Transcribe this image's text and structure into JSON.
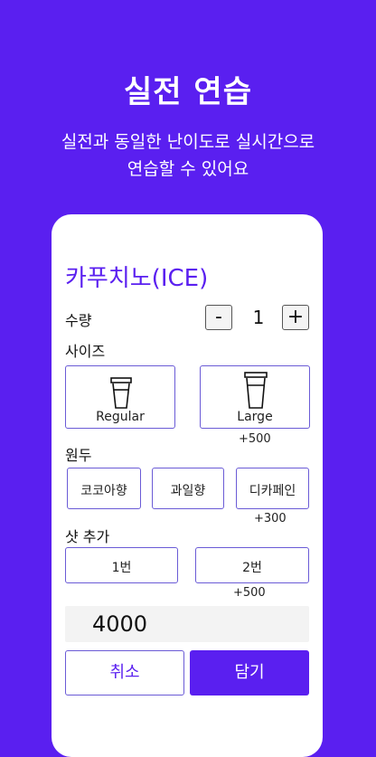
{
  "hero": {
    "title": "실전 연습",
    "subtitle_line1": "실전과 동일한 난이도로 실시간으로",
    "subtitle_line2": "연습할 수 있어요"
  },
  "product": {
    "name": "카푸치노(ICE)"
  },
  "quantity": {
    "label": "수량",
    "minus": "-",
    "value": "1",
    "plus": "+"
  },
  "size": {
    "label": "사이즈",
    "options": [
      {
        "label": "Regular",
        "extra": "",
        "icon": "cup-icon"
      },
      {
        "label": "Large",
        "extra": "+500",
        "icon": "cup-icon"
      }
    ]
  },
  "beans": {
    "label": "원두",
    "options": [
      {
        "label": "코코아향",
        "extra": ""
      },
      {
        "label": "과일향",
        "extra": ""
      },
      {
        "label": "디카페인",
        "extra": "+300"
      }
    ]
  },
  "shot": {
    "label": "샷 추가",
    "options": [
      {
        "label": "1번",
        "extra": ""
      },
      {
        "label": "2번",
        "extra": "+500"
      }
    ]
  },
  "price": {
    "total": "4000"
  },
  "actions": {
    "cancel": "취소",
    "add": "담기"
  },
  "colors": {
    "brand": "#5a1ff0",
    "border": "#6a5bd6",
    "price_bg": "#f3f3f3"
  }
}
